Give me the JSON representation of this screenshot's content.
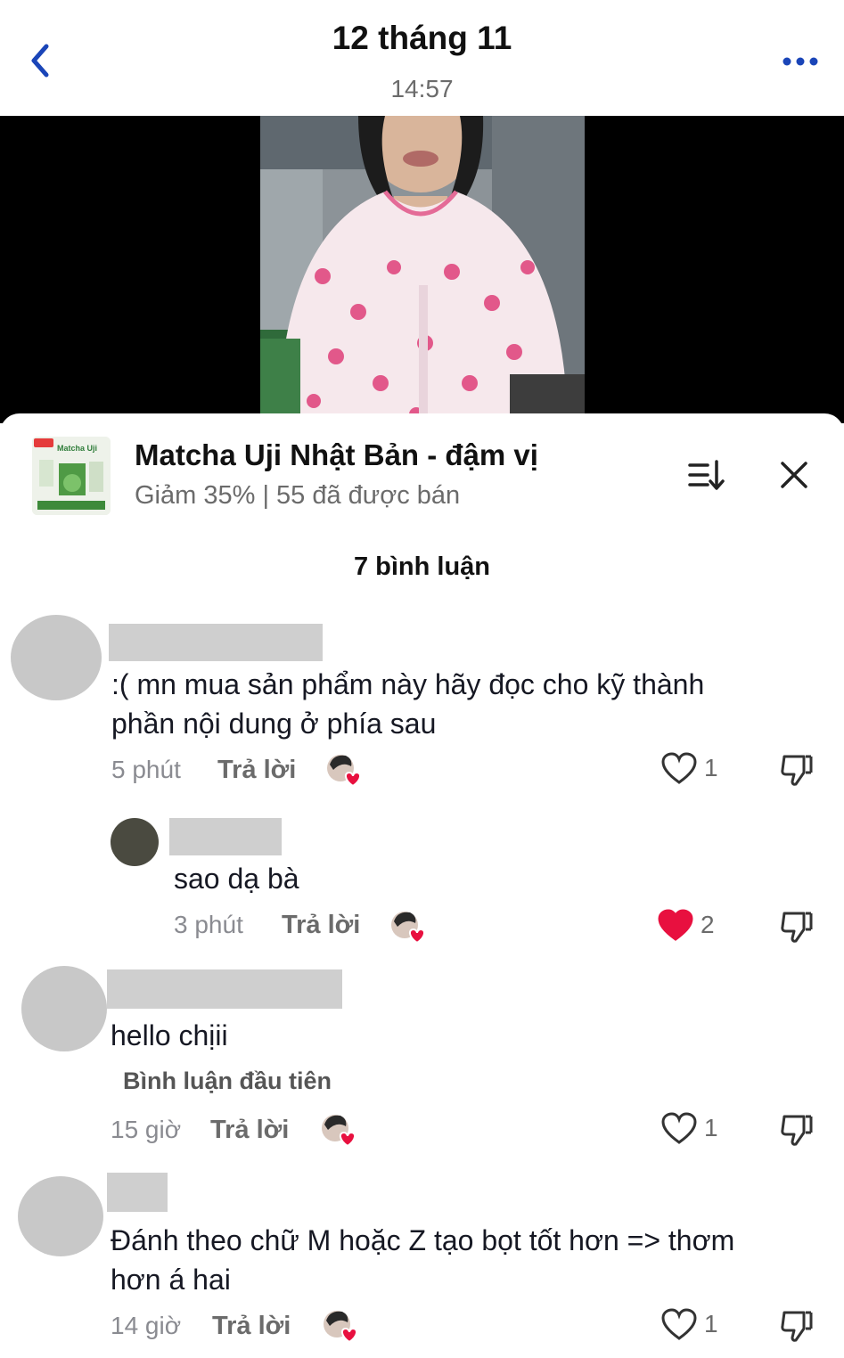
{
  "header": {
    "title": "12 tháng 11",
    "time": "14:57"
  },
  "product": {
    "name": "Matcha Uji Nhật Bản - đậm vị",
    "subtitle": "Giảm 35% | 55 đã được bán",
    "thumb_label": "Matcha Uji"
  },
  "comments_count": "7 bình luận",
  "comments": [
    {
      "text_line1": ":( mn mua sản phẩm này hãy đọc cho kỹ thành",
      "text_line2": "phần nội dung ở phía sau",
      "time": "5 phút",
      "reply_label": "Trả lời",
      "likes": "1",
      "liked": false
    },
    {
      "text_line1": "sao dạ bà",
      "time": "3 phút",
      "reply_label": "Trả lời",
      "likes": "2",
      "liked": true
    },
    {
      "text_line1": "hello chịii",
      "badge": "Bình luận đầu tiên",
      "time": "15 giờ",
      "reply_label": "Trả lời",
      "likes": "1",
      "liked": false
    },
    {
      "text_line1": "Đánh theo chữ M hoặc Z tạo bọt tốt hơn => thơm",
      "text_line2": "hơn á hai",
      "time": "14 giờ",
      "reply_label": "Trả lời",
      "likes": "1",
      "liked": false
    }
  ],
  "colors": {
    "accent_blue": "#1a45b8",
    "liked_red": "#e8103f",
    "muted_text": "#8a8b91"
  },
  "icons": [
    "back-icon",
    "more-icon",
    "sort-icon",
    "close-icon",
    "heart-icon",
    "dislike-icon"
  ]
}
